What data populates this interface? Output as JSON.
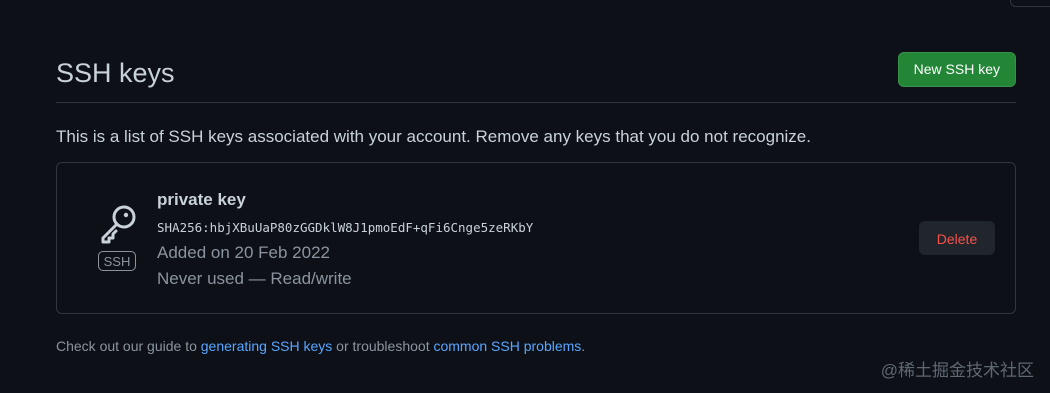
{
  "header": {
    "title": "SSH keys",
    "new_key_label": "New SSH key"
  },
  "description": "This is a list of SSH keys associated with your account. Remove any keys that you do not recognize.",
  "keys": [
    {
      "icon": "key-icon",
      "badge": "SSH",
      "name": "private key",
      "fingerprint": "SHA256:hbjXBuUaP80zGGDklW8J1pmoEdF+qFi6Cnge5zeRKbY",
      "added": "Added on 20 Feb 2022",
      "usage": "Never used — Read/write",
      "delete_label": "Delete"
    }
  ],
  "footer": {
    "prefix": "Check out our guide to ",
    "link1": "generating SSH keys",
    "middle": " or troubleshoot ",
    "link2": "common SSH problems",
    "suffix": "."
  },
  "watermark": "@稀土掘金技术社区",
  "colors": {
    "background": "#0d1117",
    "primary_button": "#238636",
    "danger_text": "#f85149",
    "link": "#58a6ff"
  }
}
